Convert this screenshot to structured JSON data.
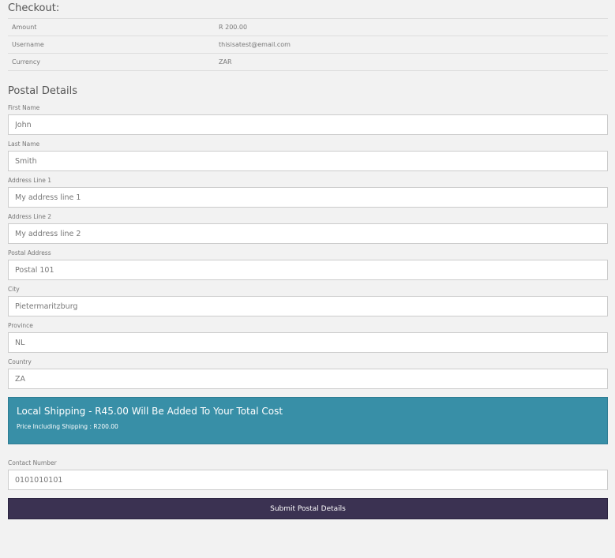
{
  "checkout": {
    "title": "Checkout:",
    "rows": [
      {
        "label": "Amount",
        "value": "R 200.00"
      },
      {
        "label": "Username",
        "value": "thisisatest@email.com"
      },
      {
        "label": "Currency",
        "value": "ZAR"
      }
    ]
  },
  "postal": {
    "title": "Postal Details",
    "fields": [
      {
        "label": "First Name",
        "value": "John",
        "placeholder": ""
      },
      {
        "label": "Last Name",
        "value": "Smith",
        "placeholder": ""
      },
      {
        "label": "Address Line 1",
        "value": "My address line 1",
        "placeholder": ""
      },
      {
        "label": "Address Line 2",
        "value": "My address line 2",
        "placeholder": ""
      },
      {
        "label": "Postal Address",
        "value": "Postal 101",
        "placeholder": ""
      },
      {
        "label": "City",
        "value": "Pietermaritzburg",
        "placeholder": ""
      },
      {
        "label": "Province",
        "value": "NL",
        "placeholder": ""
      },
      {
        "label": "Country",
        "value": "ZA",
        "placeholder": ""
      }
    ]
  },
  "shipping": {
    "title": "Local Shipping - R45.00 Will Be Added To Your Total Cost",
    "subtitle": "Price Including Shipping : R200.00",
    "color": "#388fa7"
  },
  "contact": {
    "label": "Contact Number",
    "value": "0101010101",
    "placeholder": ""
  },
  "submit": {
    "label": "Submit Postal Details",
    "color": "#3b3252"
  }
}
